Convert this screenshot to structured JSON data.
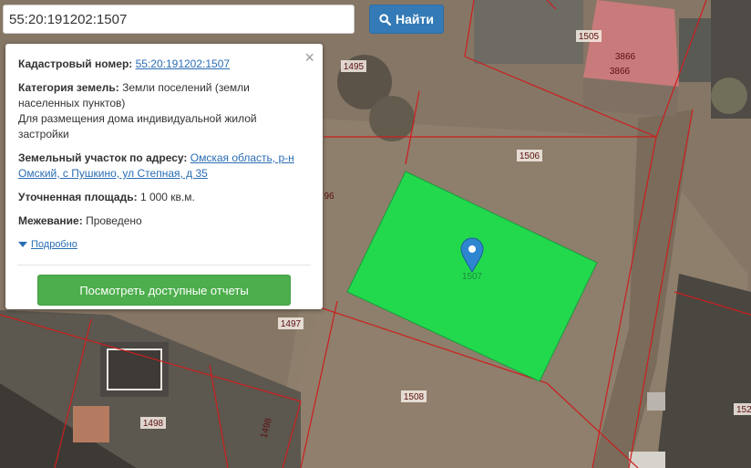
{
  "search": {
    "value": "55:20:191202:1507",
    "button_label": "Найти"
  },
  "popup": {
    "cadastral_label": "Кадастровый номер:",
    "cadastral_number": "55:20:191202:1507",
    "category_label": "Категория земель:",
    "category_value": "Земли поселений (земли населенных пунктов)",
    "usage_value": "Для размещения дома индивидуальной жилой застройки",
    "address_label": "Земельный участок по адресу:",
    "address_value": "Омская область, р-н Омский, с Пушкино, ул Степная, д 35",
    "area_label": "Уточненная площадь:",
    "area_value": "1 000 кв.м.",
    "survey_label": "Межевание:",
    "survey_value": "Проведено",
    "details_link": "Подробно",
    "reports_button": "Посмотреть доступные отчеты"
  },
  "map": {
    "parcel_labels": {
      "p1505": "1505",
      "p3866a": "3866",
      "p3866b": "3866",
      "p1495": "1495",
      "p1506": "1506",
      "p96": "96",
      "p1507": "1507",
      "p1497": "1497",
      "p1508": "1508",
      "p1498a": "1498",
      "p1498b": "1498",
      "p152": "152"
    },
    "colors": {
      "selected_parcel": "#22d94e",
      "boundary": "#cc1e1e",
      "marker": "#2f86d0"
    }
  }
}
